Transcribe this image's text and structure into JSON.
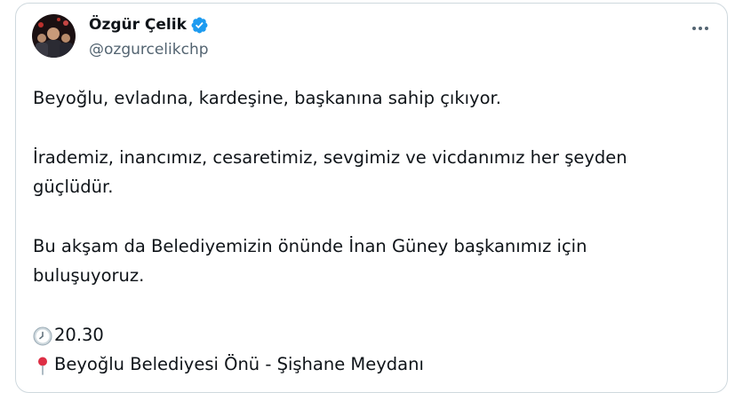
{
  "author": {
    "display_name": "Özgür Çelik",
    "handle": "@ozgurcelikchp",
    "avatar_icon": "profile-photo",
    "verified_icon": "verified-badge-icon",
    "verified_color": "#1d9bf0"
  },
  "menu": {
    "icon": "more-horizontal-icon"
  },
  "tweet": {
    "line1": "Beyoğlu, evladına, kardeşine, başkanına sahip çıkıyor.",
    "line2": "İrademiz, inancımız, cesaretimiz, sevgimiz ve vicdanımız her şeyden\ngüçlüdür.",
    "line3": "Bu akşam da Belediyemizin önünde İnan Güney başkanımız için\nbuluşuyoruz.",
    "time_icon": "clock-icon",
    "time_text": "20.30",
    "location_icon": "round-pushpin-icon",
    "location_text": "Beyoğlu Belediyesi Önü - Şişhane Meydanı"
  },
  "colors": {
    "text_primary": "#0f1419",
    "text_secondary": "#536471",
    "border": "#cfd9de"
  }
}
